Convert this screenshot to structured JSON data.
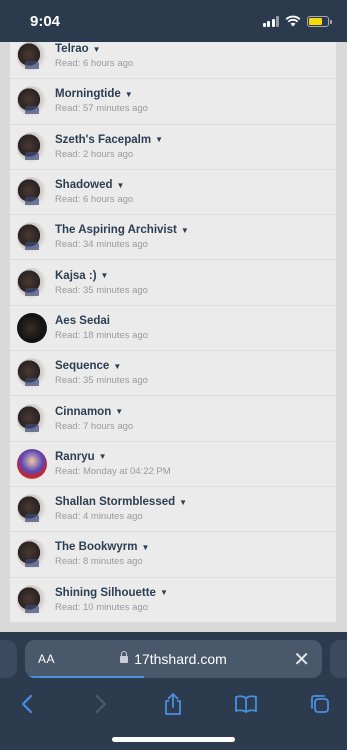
{
  "status": {
    "time": "9:04"
  },
  "users": [
    {
      "name": "Telrao",
      "read": "Read: 6 hours ago",
      "avatar": "portrait",
      "caret": true
    },
    {
      "name": "Morningtide",
      "read": "Read: 57 minutes ago",
      "avatar": "portrait",
      "caret": true
    },
    {
      "name": "Szeth's Facepalm",
      "read": "Read: 2 hours ago",
      "avatar": "portrait",
      "caret": true
    },
    {
      "name": "Shadowed",
      "read": "Read: 6 hours ago",
      "avatar": "portrait",
      "caret": true
    },
    {
      "name": "The Aspiring Archivist",
      "read": "Read: 34 minutes ago",
      "avatar": "portrait",
      "caret": true
    },
    {
      "name": "Kajsa :)",
      "read": "Read: 35 minutes ago",
      "avatar": "portrait",
      "caret": true
    },
    {
      "name": "Aes Sedai",
      "read": "Read: 18 minutes ago",
      "avatar": "dark",
      "caret": false
    },
    {
      "name": "Sequence",
      "read": "Read: 35 minutes ago",
      "avatar": "portrait",
      "caret": true
    },
    {
      "name": "Cinnamon",
      "read": "Read: 7 hours ago",
      "avatar": "portrait",
      "caret": true
    },
    {
      "name": "Ranryu",
      "read": "Read: Monday at 04:22 PM",
      "avatar": "anime",
      "caret": true
    },
    {
      "name": "Shallan Stormblessed",
      "read": "Read: 4 minutes ago",
      "avatar": "portrait",
      "caret": true
    },
    {
      "name": "The Bookwyrm",
      "read": "Read: 8 minutes ago",
      "avatar": "portrait",
      "caret": true
    },
    {
      "name": "Shining Silhouette",
      "read": "Read: 10 minutes ago",
      "avatar": "portrait",
      "caret": true
    }
  ],
  "browser": {
    "aa_label": "AA",
    "url": "17thshard.com",
    "load_progress": 0.4
  },
  "icons": {
    "back": "chevron-left-icon",
    "forward": "chevron-right-icon",
    "share": "share-icon",
    "bookmarks": "book-icon",
    "tabs": "tabs-icon"
  },
  "colors": {
    "accent": "#4a90e2",
    "name_text": "#2c3e50",
    "muted_text": "#9a9a9a"
  }
}
